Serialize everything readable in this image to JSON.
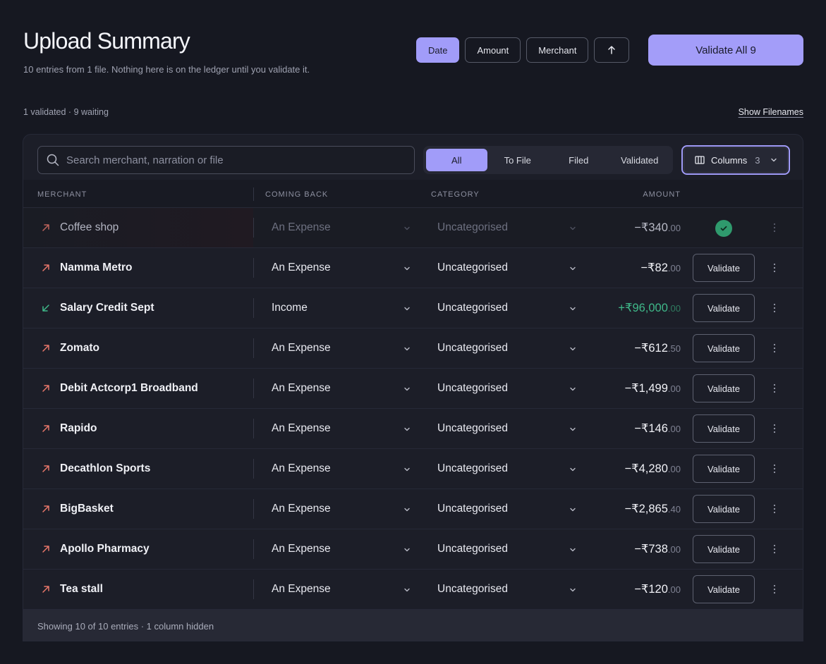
{
  "header": {
    "title": "Upload Summary",
    "subtitle": "10 entries from 1 file. Nothing here is on the ledger until you validate it.",
    "sort_options": [
      {
        "label": "Date",
        "active": true
      },
      {
        "label": "Amount",
        "active": false
      },
      {
        "label": "Merchant",
        "active": false
      }
    ],
    "sort_direction_icon": "arrow-up-icon",
    "validate_all_label": "Validate All 9",
    "status": "1 validated · 9 waiting",
    "show_filenames_label": "Show Filenames"
  },
  "toolbar": {
    "search_placeholder": "Search merchant, narration or file",
    "filter_tabs": [
      {
        "label": "All",
        "active": true
      },
      {
        "label": "To File",
        "active": false
      },
      {
        "label": "Filed",
        "active": false
      },
      {
        "label": "Validated",
        "active": false
      }
    ],
    "columns_label": "Columns",
    "columns_count": "3"
  },
  "table": {
    "headers": {
      "merchant": "MERCHANT",
      "coming_back": "COMING BACK",
      "category": "CATEGORY",
      "amount": "AMOUNT"
    },
    "validate_label": "Validate",
    "rows": [
      {
        "merchant": "Coffee shop",
        "direction": "outgoing",
        "coming_back": "An Expense",
        "category": "Uncategorised",
        "amount_main": "−₹340",
        "amount_paise": ".00",
        "validated": true
      },
      {
        "merchant": "Namma Metro",
        "direction": "outgoing",
        "coming_back": "An Expense",
        "category": "Uncategorised",
        "amount_main": "−₹82",
        "amount_paise": ".00",
        "validated": false
      },
      {
        "merchant": "Salary Credit Sept",
        "direction": "incoming",
        "coming_back": "Income",
        "category": "Uncategorised",
        "amount_main": "+₹96,000",
        "amount_paise": ".00",
        "validated": false
      },
      {
        "merchant": "Zomato",
        "direction": "outgoing",
        "coming_back": "An Expense",
        "category": "Uncategorised",
        "amount_main": "−₹612",
        "amount_paise": ".50",
        "validated": false
      },
      {
        "merchant": "Debit Actcorp1 Broadband",
        "direction": "outgoing",
        "coming_back": "An Expense",
        "category": "Uncategorised",
        "amount_main": "−₹1,499",
        "amount_paise": ".00",
        "validated": false
      },
      {
        "merchant": "Rapido",
        "direction": "outgoing",
        "coming_back": "An Expense",
        "category": "Uncategorised",
        "amount_main": "−₹146",
        "amount_paise": ".00",
        "validated": false
      },
      {
        "merchant": "Decathlon Sports",
        "direction": "outgoing",
        "coming_back": "An Expense",
        "category": "Uncategorised",
        "amount_main": "−₹4,280",
        "amount_paise": ".00",
        "validated": false
      },
      {
        "merchant": "BigBasket",
        "direction": "outgoing",
        "coming_back": "An Expense",
        "category": "Uncategorised",
        "amount_main": "−₹2,865",
        "amount_paise": ".40",
        "validated": false
      },
      {
        "merchant": "Apollo Pharmacy",
        "direction": "outgoing",
        "coming_back": "An Expense",
        "category": "Uncategorised",
        "amount_main": "−₹738",
        "amount_paise": ".00",
        "validated": false
      },
      {
        "merchant": "Tea stall",
        "direction": "outgoing",
        "coming_back": "An Expense",
        "category": "Uncategorised",
        "amount_main": "−₹120",
        "amount_paise": ".00",
        "validated": false
      }
    ],
    "footer": "Showing 10 of 10 entries · 1 column hidden"
  },
  "colors": {
    "accent": "#a19cf9",
    "outgoing": "#e8776a",
    "incoming": "#3fb889",
    "validated": "#2f9a6d"
  }
}
